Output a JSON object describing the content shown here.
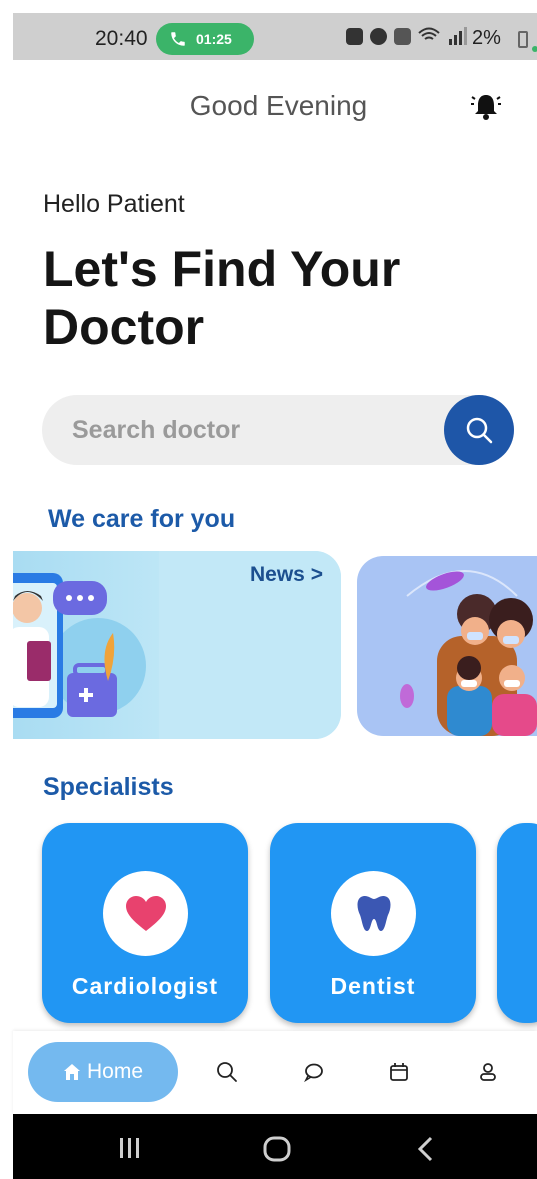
{
  "status_bar": {
    "time": "20:40",
    "call_timer": "01:25",
    "battery": "2%",
    "call_color": "#3bb469"
  },
  "header": {
    "greeting": "Good Evening",
    "bell_icon": "alarm-bell-icon"
  },
  "hero": {
    "hello": "Hello Patient",
    "headline": "Let's Find Your Doctor"
  },
  "search": {
    "placeholder": "Search doctor",
    "button_icon": "search-icon",
    "button_color": "#1e56a8"
  },
  "care_section": {
    "title": "We care for you",
    "cards": [
      {
        "label": "News",
        "arrow": ">"
      }
    ]
  },
  "specialists_section": {
    "title": "Specialists",
    "items": [
      {
        "label": "Cardiologist",
        "icon": "heart-icon"
      },
      {
        "label": "Dentist",
        "icon": "tooth-icon"
      }
    ],
    "card_color": "#2196f3"
  },
  "bottom_nav": {
    "items": [
      {
        "label": "Home",
        "icon": "home-icon",
        "active": true
      },
      {
        "icon": "search-icon"
      },
      {
        "icon": "chat-icon"
      },
      {
        "icon": "calendar-icon"
      },
      {
        "icon": "profile-icon"
      }
    ]
  },
  "system_nav": {
    "buttons": [
      "recents",
      "home",
      "back"
    ]
  }
}
